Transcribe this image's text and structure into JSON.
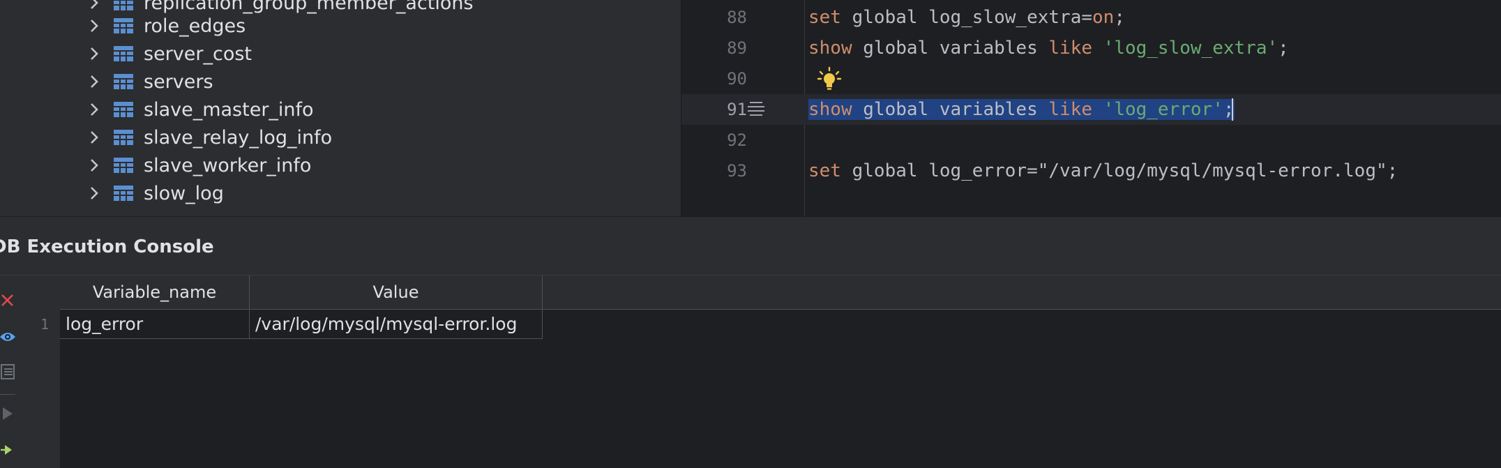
{
  "tree": {
    "items": [
      {
        "label": "replication_group_member_actions"
      },
      {
        "label": "role_edges"
      },
      {
        "label": "server_cost"
      },
      {
        "label": "servers"
      },
      {
        "label": "slave_master_info"
      },
      {
        "label": "slave_relay_log_info"
      },
      {
        "label": "slave_worker_info"
      },
      {
        "label": "slow_log"
      }
    ]
  },
  "editor": {
    "lines": [
      {
        "num": "88"
      },
      {
        "num": "89"
      },
      {
        "num": "90"
      },
      {
        "num": "91"
      },
      {
        "num": "92"
      },
      {
        "num": "93"
      }
    ],
    "code": {
      "l88_kw": "set",
      "l88_rest": " global log_slow_extra=",
      "l88_val": "on",
      "l88_end": ";",
      "l89_kw1": "show",
      "l89_mid": " global variables ",
      "l89_kw2": "like",
      "l89_str": " 'log_slow_extra'",
      "l89_end": ";",
      "l91_kw1": "show",
      "l91_mid": " global variables ",
      "l91_kw2": "like",
      "l91_str": " 'log_error'",
      "l91_end": ";",
      "l93_kw": "set",
      "l93_rest": " global log_error=\"/var/log/mysql/mysql-error.log\";"
    }
  },
  "console": {
    "title": "DB Execution Console",
    "columns": [
      "Variable_name",
      "Value"
    ],
    "rows": [
      {
        "num": "1",
        "cells": [
          "log_error",
          "/var/log/mysql/mysql-error.log"
        ]
      }
    ]
  },
  "colors": {
    "keyword": "#cf8e6d",
    "string": "#6aab73",
    "selection": "#214283",
    "close_red": "#e5484d",
    "eye_blue": "#54a3f0",
    "run_green": "#a9d36a"
  }
}
